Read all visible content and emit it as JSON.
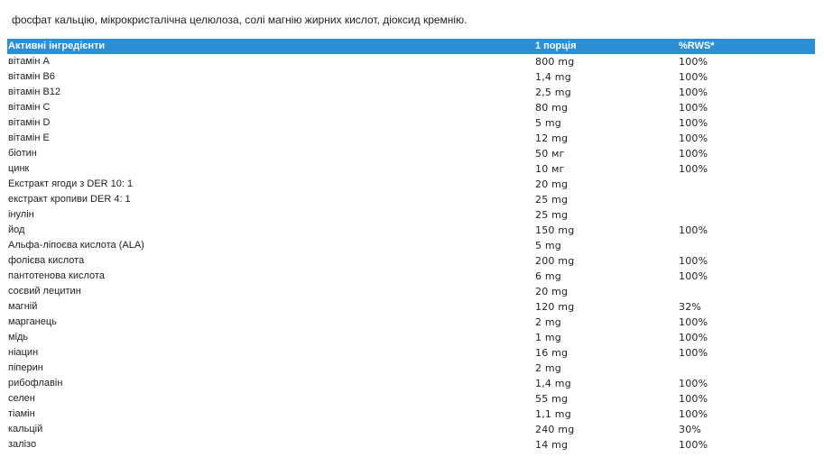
{
  "intro_text": "фосфат кальцію, мікрокристалічна целюлоза, солі магнію жирних кислот, діоксид кремнію.",
  "table": {
    "header": {
      "ingredient": "Активні інгредієнти",
      "portion": "1 порція",
      "rws": "%RWS*"
    },
    "rows": [
      {
        "name": "вітамін A",
        "amount": "800 mg",
        "rws": "100%"
      },
      {
        "name": "вітамін B6",
        "amount": "1,4 mg",
        "rws": "100%"
      },
      {
        "name": "вітамін B12",
        "amount": "2,5 mg",
        "rws": "100%"
      },
      {
        "name": "вітамін C",
        "amount": "80 mg",
        "rws": "100%"
      },
      {
        "name": "вітамін D",
        "amount": "5 mg",
        "rws": "100%"
      },
      {
        "name": "вітамін E",
        "amount": "12 mg",
        "rws": "100%"
      },
      {
        "name": "біотин",
        "amount": "50 мг",
        "rws": "100%"
      },
      {
        "name": "цинк",
        "amount": "10 мг",
        "rws": "100%"
      },
      {
        "name": "Екстракт ягоди з DER 10: 1",
        "amount": "20 mg",
        "rws": ""
      },
      {
        "name": "екстракт кропиви DER 4: 1",
        "amount": "25 mg",
        "rws": ""
      },
      {
        "name": "інулін",
        "amount": "25 mg",
        "rws": ""
      },
      {
        "name": "йод",
        "amount": "150 mg",
        "rws": "100%"
      },
      {
        "name": "Альфа-ліпоєва кислота (ALA)",
        "amount": "5 mg",
        "rws": ""
      },
      {
        "name": "фолієва кислота",
        "amount": "200 mg",
        "rws": "100%"
      },
      {
        "name": "пантотенова кислота",
        "amount": "6 mg",
        "rws": "100%"
      },
      {
        "name": "соєвий лецитин",
        "amount": "20 mg",
        "rws": ""
      },
      {
        "name": "магній",
        "amount": "120 mg",
        "rws": "32%"
      },
      {
        "name": "марганець",
        "amount": "2 mg",
        "rws": "100%"
      },
      {
        "name": "мідь",
        "amount": "1 mg",
        "rws": "100%"
      },
      {
        "name": "ніацин",
        "amount": "16 mg",
        "rws": "100%"
      },
      {
        "name": "піперин",
        "amount": "2 mg",
        "rws": ""
      },
      {
        "name": "рибофлавін",
        "amount": "1,4 mg",
        "rws": "100%"
      },
      {
        "name": "селен",
        "amount": "55 mg",
        "rws": "100%"
      },
      {
        "name": "тіамін",
        "amount": "1,1 mg",
        "rws": "100%"
      },
      {
        "name": "кальцій",
        "amount": "240 mg",
        "rws": "30%"
      },
      {
        "name": "залізо",
        "amount": "14 mg",
        "rws": "100%"
      }
    ]
  },
  "colors": {
    "header_bg": "#2b8fd6",
    "header_text": "#ffffff",
    "body_text": "#222222"
  }
}
